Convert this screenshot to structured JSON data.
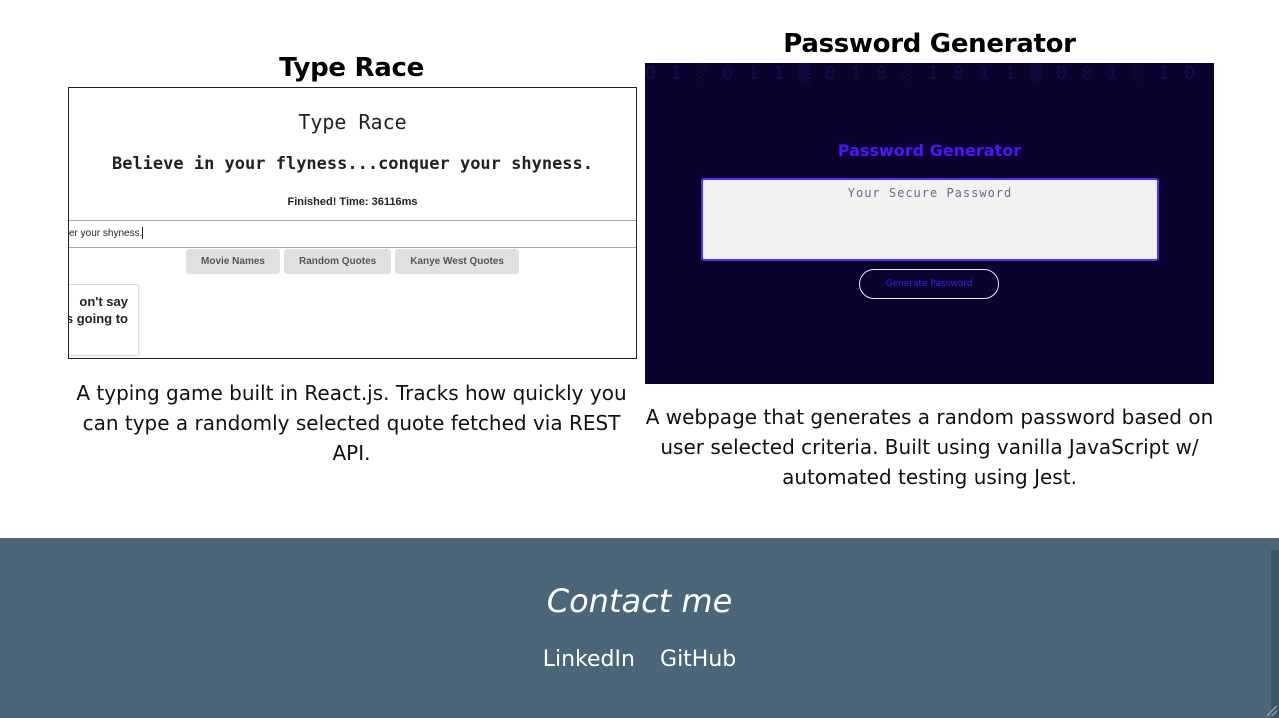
{
  "projects": [
    {
      "title": "Type Race",
      "description": "A typing game built in React.js. Tracks how quickly you can type a randomly selected quote fetched via REST API.",
      "screenshot": {
        "app_title": "Type Race",
        "quote": "Believe in your flyness...conquer your shyness.",
        "status": "Finished! Time: 36116ms",
        "input_value": "er your shyness.",
        "buttons": [
          "Movie Names",
          "Random Quotes",
          "Kanye West Quotes"
        ],
        "card_text": "on't say\n's going to"
      }
    },
    {
      "title": "Password Generator",
      "description": "A webpage that generates a random password based on user selected criteria. Built using vanilla JavaScript w/ automated testing using Jest.",
      "screenshot": {
        "app_title": "Password Generator",
        "placeholder": "Your Secure Password",
        "button": "Generate Password"
      }
    }
  ],
  "footer": {
    "title": "Contact me",
    "links": [
      "LinkedIn",
      "GitHub"
    ]
  },
  "colors": {
    "footer_bg": "#4b6579",
    "pw_accent": "#4b16ff",
    "pw_bg": "#09032e"
  }
}
